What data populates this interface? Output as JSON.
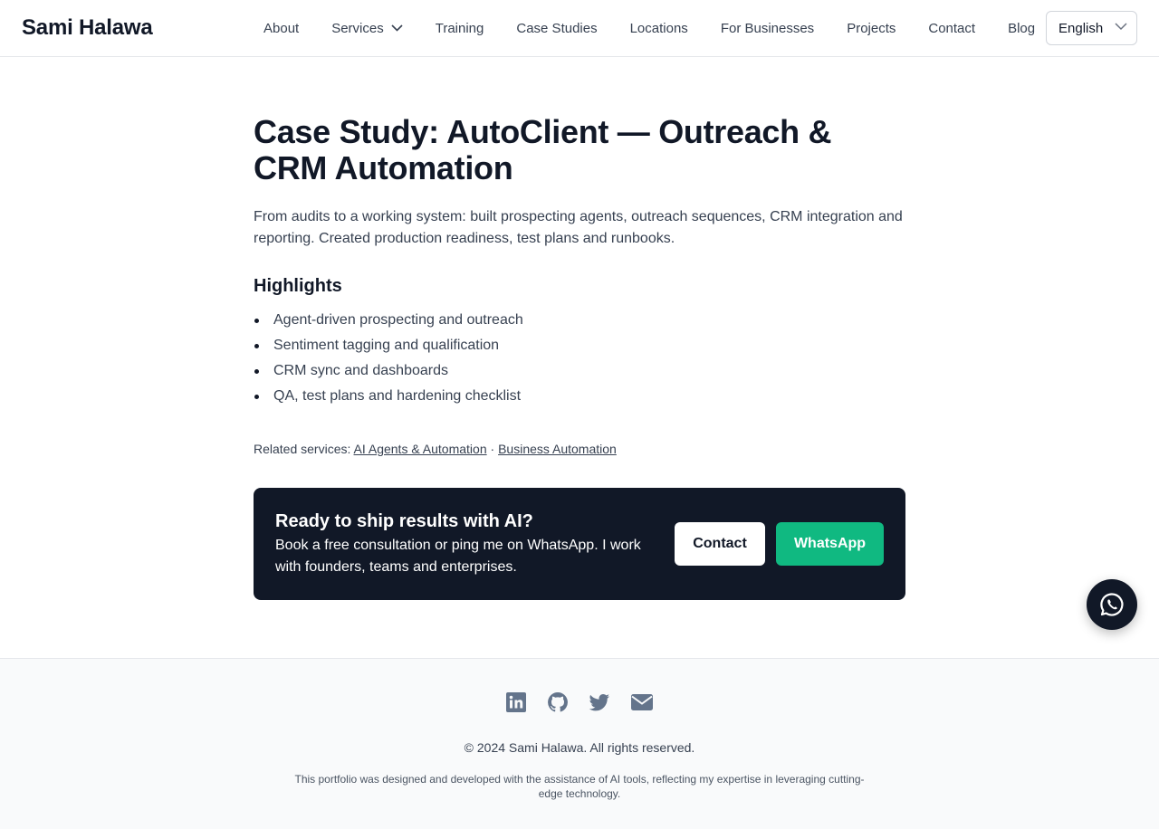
{
  "header": {
    "brand": "Sami Halawa",
    "nav": [
      {
        "label": "About"
      },
      {
        "label": "Services"
      },
      {
        "label": "Training"
      },
      {
        "label": "Case Studies"
      },
      {
        "label": "Locations"
      },
      {
        "label": "For Businesses"
      },
      {
        "label": "Projects"
      },
      {
        "label": "Contact"
      },
      {
        "label": "Blog"
      }
    ],
    "language": "English"
  },
  "main": {
    "title": "Case Study: AutoClient — Outreach & CRM Automation",
    "lede": "From audits to a working system: built prospecting agents, outreach sequences, CRM integration and reporting. Created production readiness, test plans and runbooks.",
    "highlights_heading": "Highlights",
    "highlights": [
      "Agent-driven prospecting and outreach",
      "Sentiment tagging and qualification",
      "CRM sync and dashboards",
      "QA, test plans and hardening checklist"
    ],
    "related_label": "Related services:",
    "related_links": [
      "AI Agents & Automation",
      "Business Automation"
    ],
    "related_sep": "·"
  },
  "cta": {
    "title": "Ready to ship results with AI?",
    "text": "Book a free consultation or ping me on WhatsApp. I work with founders, teams and enterprises.",
    "contact_label": "Contact",
    "whatsapp_label": "WhatsApp"
  },
  "footer": {
    "socials": [
      "linkedin-icon",
      "github-icon",
      "twitter-icon",
      "mail-icon"
    ],
    "copyright": "© 2024 Sami Halawa. All rights reserved.",
    "note": "This portfolio was designed and developed with the assistance of AI tools, reflecting my expertise in leveraging cutting-edge technology."
  },
  "colors": {
    "dark": "#111827",
    "accent_green": "#10b981",
    "footer_bg": "#f9fafb",
    "social_icon": "#64748b"
  }
}
